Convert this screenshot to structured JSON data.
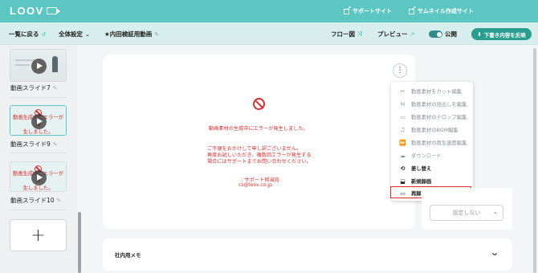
{
  "topbar": {
    "logo": "LOOV",
    "links": [
      "サポートサイト",
      "サムネイル作成サイト"
    ]
  },
  "toolbar": {
    "back_label": "一覧に戻る",
    "global_settings_label": "全体設定",
    "video_title": "★内田検証用動画",
    "flow_label": "フロー図",
    "preview_label": "プレビュー",
    "publish_label": "公開",
    "reflect_button": "下書き内容を反映"
  },
  "sidebar": {
    "slides": [
      {
        "label": "動画スライド7",
        "error": false
      },
      {
        "label": "動画スライド9",
        "error": true,
        "error_text_lines": [
          "動画生成中にエラーが発",
          "生しました。"
        ]
      },
      {
        "label": "動画スライド10",
        "error": true,
        "error_text_lines": [
          "動画生成中にエラーが発",
          "生しました。"
        ]
      }
    ],
    "add_label": "+"
  },
  "main": {
    "error_title": "動画素材の生成中にエラーが発生しました。",
    "error_body": [
      "ご不便をおかけして申し訳ございません。",
      "再度お試しいただき、複数回エラーが発生する",
      "場合にはサポートまでお問い合わせください。"
    ],
    "support_label": "♡サポート担当宛",
    "support_email": "cs@loov.co.jp"
  },
  "menu": {
    "items": [
      {
        "label": "動画素材をカット編集",
        "icon": "scissors-icon",
        "enabled": false
      },
      {
        "label": "動画素材の見出しを編集",
        "icon": "heading-icon",
        "enabled": false
      },
      {
        "label": "動画素材のテロップ編集",
        "icon": "caption-icon",
        "enabled": false
      },
      {
        "label": "動画素材のBGM編集",
        "icon": "music-icon",
        "enabled": false
      },
      {
        "label": "動画素材の再生速度編集",
        "icon": "speed-icon",
        "enabled": false
      },
      {
        "label": "ダウンロード",
        "icon": "cloud-download-icon",
        "enabled": false
      },
      {
        "label": "差し替え",
        "icon": "swap-icon",
        "enabled": true
      },
      {
        "label": "新規録画",
        "icon": "new-record-icon",
        "enabled": true
      },
      {
        "label": "再録画",
        "icon": "video-camera-icon",
        "enabled": true
      }
    ],
    "highlighted_index": 8
  },
  "right_panel": {
    "select_value": "設定しない"
  },
  "memo": {
    "label": "社内用メモ"
  },
  "colors": {
    "brand": "#5cc6c2",
    "error": "#d32f2f",
    "highlight": "#e02a2a"
  }
}
